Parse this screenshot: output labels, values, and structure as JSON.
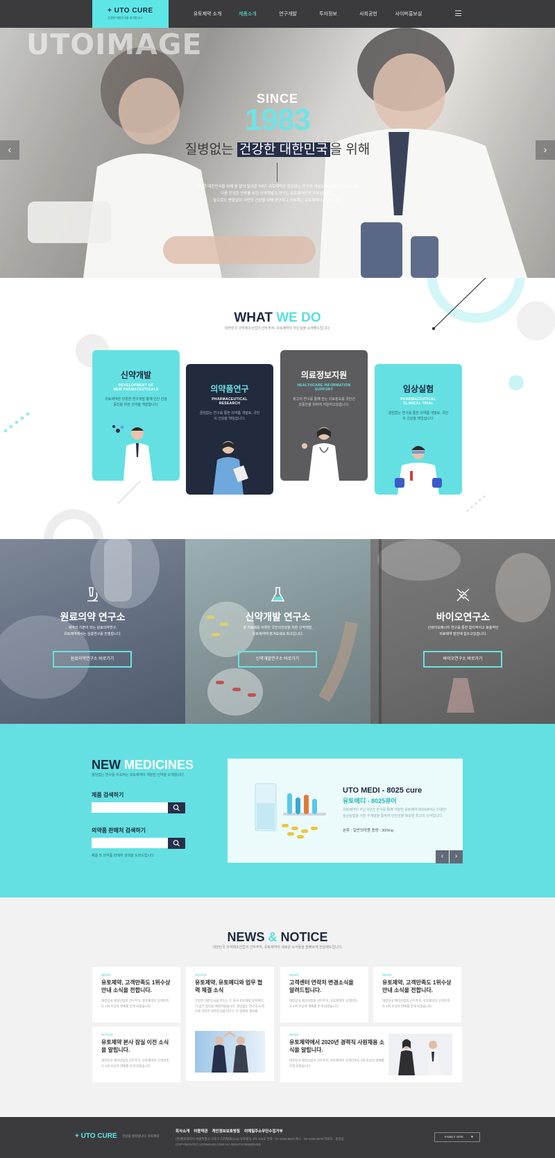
{
  "header": {
    "logo_text": "UTO CURE",
    "logo_sub": "건강한 대한민국을 생각합니다",
    "nav": [
      "유토제약 소개",
      "제품소개",
      "연구개발",
      "투자정보",
      "사회공헌",
      "사이버홍보실"
    ],
    "active_nav_index": 1
  },
  "hero": {
    "watermark": "UTOIMAGE",
    "since": "SINCE",
    "year": "1983",
    "slogan_pre": "질병없는",
    "slogan_highlight": "건강한 대한민국",
    "slogan_post": "을 위해",
    "body_lines": [
      "건강한 대한민국을 위해 쉼 없이 달려온 39년, 유토제약은 끊임없는 연구와 개발로 역사를 만들었습니다.",
      "다음 건강한 인류를 위한 신약개발과 연구는 유토제약만의 자부심입니다.",
      "앞으로도 변함없이 국민의 건강을 위해 연구하고 공부하는 유토제약이 되겠습니다."
    ],
    "prev_arrow": "‹",
    "next_arrow": "›"
  },
  "what_we_do": {
    "title_dark": "WHAT",
    "title_accent": "WE DO",
    "subtitle": "대한민국 의약제조산업의 선두주자, 유토제약이 하는일을 소개해드립니다.",
    "cards": [
      {
        "title": "신약개발",
        "english": [
          "DEVELOPMENT OF",
          "NEW PARMACEUTICALS"
        ],
        "desc": "유토제약은 다양한 연구개발 통해 인간 건강증진을 위한 신약을 개발합니다."
      },
      {
        "title": "의약품연구",
        "english": [
          "PHARMACEUTICAL",
          "RESEARCH"
        ],
        "desc": "끊임없는 연구를 통한 의약품 개발로, 국민의 건강을 책임집니다."
      },
      {
        "title": "의료정보지원",
        "english": [
          "HEALTHCARE INFORMATION",
          "SUPPORT"
        ],
        "desc": "최고의 연구를 통해 얻는 의료정보를 국민건강증진을 위하여 지원하고있습니다."
      },
      {
        "title": "임상실험",
        "english": [
          "PHARMACEUTICAL",
          "CLINICAL TRIAL"
        ],
        "desc": "끊임없는 연구를 통한 의약품 개발로, 국민의 건강을 책임집니다."
      }
    ]
  },
  "research": [
    {
      "title": "원료의약 연구소",
      "desc": [
        "제약의 기본이 되는 원료의약연구,",
        "유토제약에서는 심층연구를 진행합니다."
      ],
      "button": "원료의약연구소 바로가기",
      "icon": "microscope-icon"
    },
    {
      "title": "신약개발 연구소",
      "desc": [
        "영 치료제를 비롯한 국민의건강을 위한 신약개발,",
        "유토제약에 맡겨보세요 최고입니다."
      ],
      "button": "신약개발연구소 바로가기",
      "icon": "flask-icon"
    },
    {
      "title": "바이오연구소",
      "desc": [
        "신바이오에너지 연구를 통한 합리적이고 효율적인",
        "의료제약 발전에 힘쓰고있습니다."
      ],
      "button": "바이오연구소 바로가기",
      "icon": "dna-icon"
    }
  ],
  "new_medicines": {
    "title_dark": "NEW",
    "title_light": "MEDICINES",
    "subtitle": "끊임없는 연구를 지속하는 유토제약이 개발한 신약을 소개합니다.",
    "search_label": "제품 검색하기",
    "pharmacy_label": "의약품 판매처 검색하기",
    "note": "제품 및 의약품 판매처 검색을 도와드립니다.",
    "product": {
      "name": "UTO MEDI - 8025 cure",
      "korean": "유토메디 - 8025큐어",
      "desc": "유토제약이 지난 4년간 연구를 통해 개발한 유토제약 8025큐어는 다양한 임상실험을 거친 우개발을 통하여 안전성을 확보한 최고의 신약입니다.",
      "spec": "분류 : 일반의약품   용량 : 300mg"
    },
    "prev": "‹",
    "next": "›"
  },
  "news": {
    "title_dark": "NEWS",
    "amp": "&",
    "title_dark2": "NOTICE",
    "subtitle": "대한민국 의약제조산업의 선두주자, 유토제약의 새로운 소식들을 발빠르게 전달해드립니다.",
    "items": [
      {
        "tag": "NEWS",
        "title": "유토제약, 고객만족도 1위수상안내 소식을 전합니다.",
        "body": "대한민국 제약산업의 선두주자, 유토제약이 고객만족도 1위 수상의 영예를 안게 되었습니다."
      },
      {
        "tag": "NOTICE",
        "title": "유토제약, 유토메디와 업무 협력 체결 소식",
        "body": "건강한 대한민국을 만드는 두 회사 유토제약 유토메디가 업무 협력을 체결하였습니다. 끊임없는 연구와 노력으로 건강한 대한민국을 만드는 두 업체의 행보를"
      },
      {
        "tag": "NEWS",
        "title": "고객센터 연락처 변경소식을 알려드립니다.",
        "body": "대한민국 제약산업의 선두주자, 유토제약이 고객만족도 1위 수상의 영예를 안게 되었습니다."
      },
      {
        "tag": "NEWS",
        "title": "유토제약, 고객만족도 1위수상안내 소식을 전합니다.",
        "body": "대한민국 제약산업의 선두주자, 유토제약이 고객만족도 1위 수상의 영예를 안게 되었습니다."
      },
      {
        "tag": "NOTICE",
        "title": "유토제약 본사 잠실 이전 소식을 알립니다.",
        "body": "대한민국 제약산업의 선두주자, 유토제약이 고객만족도 1위 수상의 영예를 안게 되었습니다."
      },
      {
        "tag": "NEWS",
        "title": "유토제약에서 2020년 경력직 사원채용 소식을 알립니다.",
        "body": "대한민국 제약산업의 선두주자, 유토제약이 고객만족도 1위 수상의 영예를 안게 되었습니다."
      }
    ]
  },
  "footer": {
    "logo": "UTO CURE",
    "logo_sub": "건강을 생각합니다. 유토제약",
    "links": [
      "회사소개",
      "이용약관",
      "개인정보보호방침",
      "이메일주소무단수집거부"
    ],
    "info": [
      "(주)제조약하이 서울특별시 구로구 디지털로(123) 유토빌딩 2차 105호   전화 : 02-1234-5678   팩스 : 02-1234-5678   대표자 : 홍길동",
      "COPYRIGHT(C) UTOIMAGE.COM ALL RIGHTS RESERVED."
    ],
    "family_site": "FAMILY SITE"
  },
  "colors": {
    "accent": "#5ee6e6",
    "navy": "#27304a",
    "header": "#3b3b3d"
  }
}
